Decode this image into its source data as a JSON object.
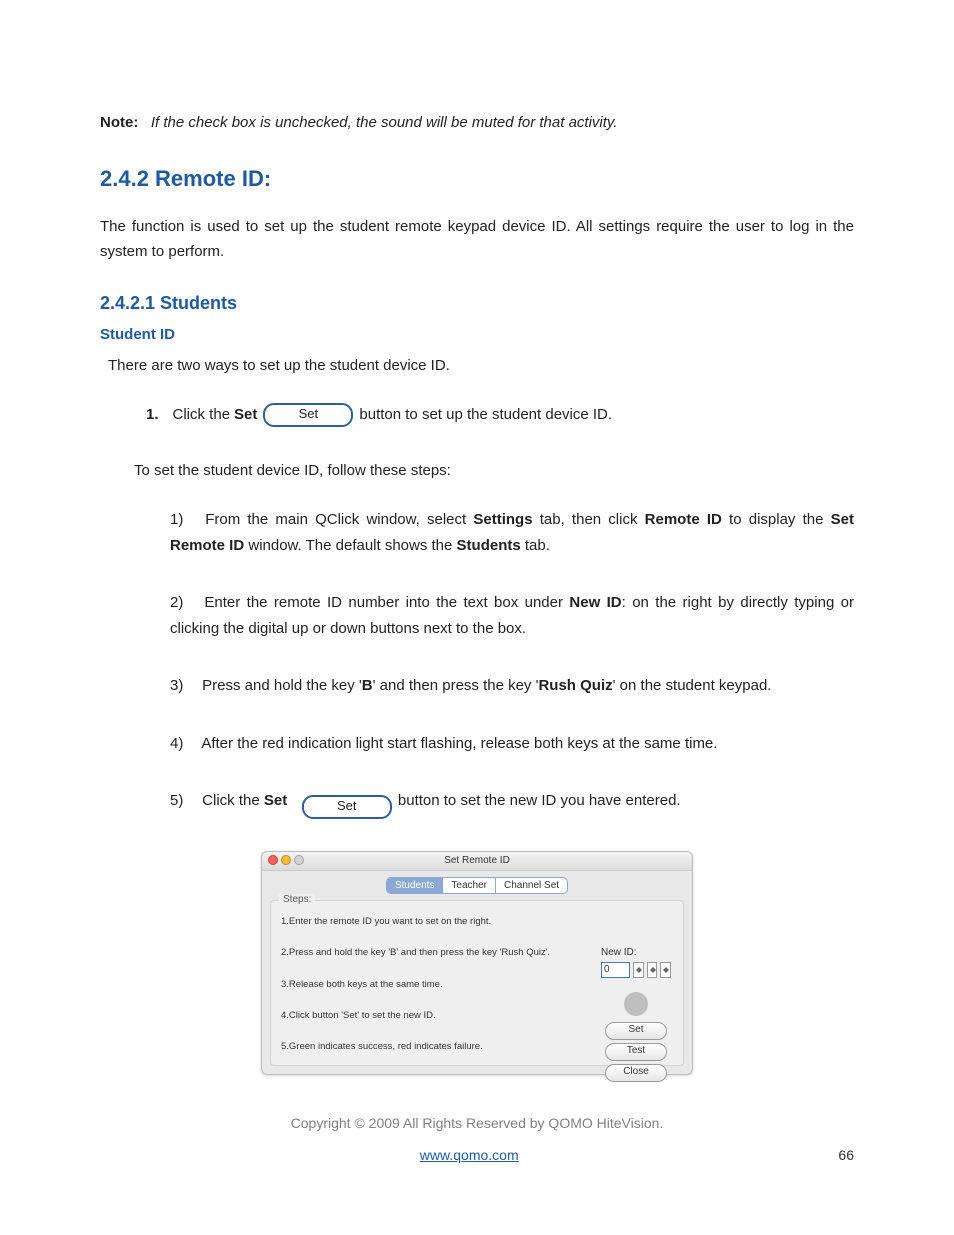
{
  "note": {
    "label": "Note:",
    "body": "If the check box is unchecked, the sound will be muted for that activity."
  },
  "h242": "2.4.2  Remote ID:",
  "p242": "The function is used to set up the student remote keypad device ID. All settings require the user to log in the system to perform.",
  "h2421": "2.4.2.1 Students",
  "student_id_h": "Student ID",
  "intro": "There are two ways to set up the student device ID.",
  "method1": {
    "num": "1.",
    "pre": "Click the ",
    "bold": "Set",
    "btn": "Set",
    "post": " button to set up the student device ID."
  },
  "follow": "To set the student device ID, follow these steps:",
  "steps": {
    "s1": {
      "n": "1)",
      "a": "From the main QClick window, select ",
      "b1": "Settings",
      "c": " tab, then click ",
      "b2": "Remote ID",
      "d": " to display the ",
      "b3": "Set Remote ID",
      "e": " window. The default shows the ",
      "b4": "Students",
      "f": " tab."
    },
    "s2": {
      "n": "2)",
      "a": "Enter the remote ID number into the text box under ",
      "b1": "New ID",
      "b": ": on the right by directly typing or clicking the digital up or down buttons next to the box."
    },
    "s3": {
      "n": "3)",
      "a": "Press and hold the key '",
      "b1": "B",
      "b": "' and then press the key '",
      "b2": "Rush Quiz",
      "c": "' on the student keypad."
    },
    "s4": {
      "n": "4)",
      "a": "After the red indication light start flashing, release both keys at the same time."
    },
    "s5": {
      "n": "5)",
      "a": "Click the ",
      "b1": "Set",
      "btn": "Set",
      "b": "button to set the new ID you have entered."
    }
  },
  "win": {
    "title": "Set Remote ID",
    "tabs": {
      "t1": "Students",
      "t2": "Teacher",
      "t3": "Channel Set"
    },
    "legend": "Steps:",
    "ws1": "1.Enter the remote ID you want to set on the right.",
    "ws2": "2.Press and hold the key 'B' and then press the key 'Rush Quiz'.",
    "ws3": "3.Release both keys at the same time.",
    "ws4": "4.Click button 'Set' to set the new ID.",
    "ws5": "5.Green indicates success, red indicates failure.",
    "newid_label": "New ID:",
    "newid_value": "0",
    "btn_set": "Set",
    "btn_test": "Test",
    "btn_close": "Close"
  },
  "copyright": "Copyright © 2009 All Rights Reserved by QOMO HiteVision.",
  "footer_link": "www.qomo.com",
  "page_number": "66"
}
